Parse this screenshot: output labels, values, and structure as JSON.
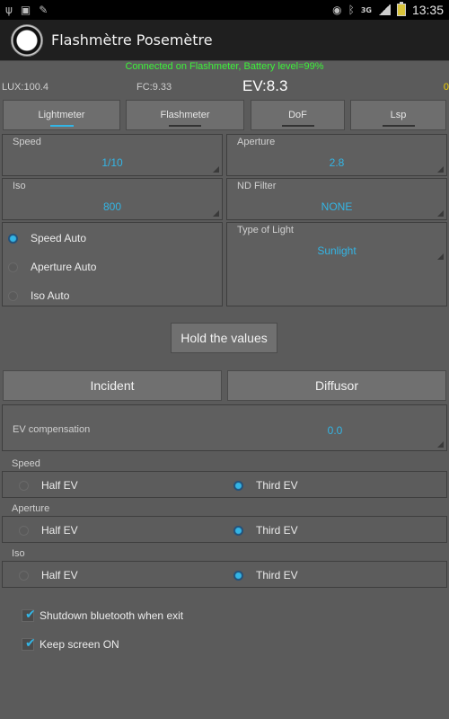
{
  "status_bar": {
    "icons_left": [
      "usb-icon",
      "image-icon",
      "pen-icon"
    ],
    "icons_right": [
      "eye-icon",
      "bluetooth-icon",
      "3g-icon",
      "signal-icon",
      "battery-icon"
    ],
    "network": "3G",
    "time": "13:35"
  },
  "app": {
    "title": "Flashmètre Posemètre"
  },
  "connection": "Connected on Flashmeter, Battery level=99%",
  "readings": {
    "lux": "LUX:100.4",
    "fc": "FC:9.33",
    "ev": "EV:8.3",
    "right_value": "0"
  },
  "tabs": [
    "Lightmeter",
    "Flashmeter",
    "DoF",
    "Lsp"
  ],
  "settings": {
    "speed": {
      "label": "Speed",
      "value": "1/10"
    },
    "aperture": {
      "label": "Aperture",
      "value": "2.8"
    },
    "iso": {
      "label": "Iso",
      "value": "800"
    },
    "nd_filter": {
      "label": "ND Filter",
      "value": "NONE"
    },
    "auto_mode": {
      "options": [
        "Speed Auto",
        "Aperture Auto",
        "Iso Auto"
      ],
      "selected": "Speed Auto"
    },
    "type_of_light": {
      "label": "Type of Light",
      "value": "Sunlight"
    }
  },
  "buttons": {
    "hold": "Hold the values",
    "incident": "Incident",
    "diffusor": "Diffusor"
  },
  "ev_compensation": {
    "label": "EV compensation",
    "value": "0.0"
  },
  "steps": {
    "speed": {
      "label": "Speed",
      "half": "Half EV",
      "third": "Third EV",
      "selected": "Third EV"
    },
    "aperture": {
      "label": "Aperture",
      "half": "Half EV",
      "third": "Third EV",
      "selected": "Third EV"
    },
    "iso": {
      "label": "Iso",
      "half": "Half EV",
      "third": "Third EV",
      "selected": "Third EV"
    }
  },
  "options": {
    "shutdown_bluetooth": {
      "label": "Shutdown bluetooth when exit",
      "checked": true
    },
    "keep_screen_on": {
      "label": "Keep screen ON",
      "checked": true
    }
  },
  "colors": {
    "accent": "#33b5e5",
    "connection_text": "#3df23a",
    "background": "#5b5b5b"
  }
}
